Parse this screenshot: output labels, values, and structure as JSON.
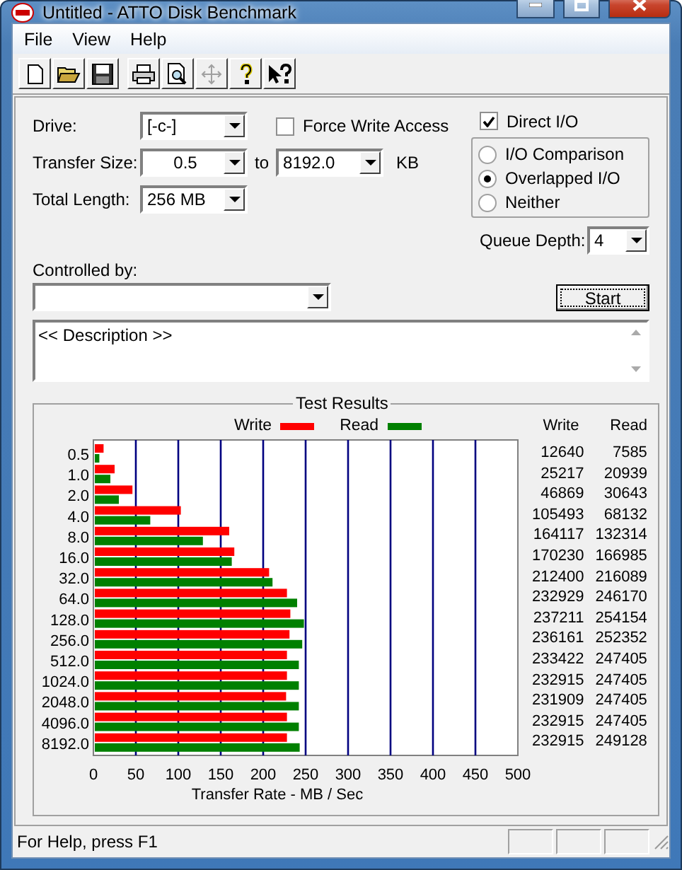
{
  "window": {
    "title": "Untitled - ATTO Disk Benchmark"
  },
  "menu": [
    {
      "label": "File"
    },
    {
      "label": "View"
    },
    {
      "label": "Help"
    }
  ],
  "toolbar": [
    {
      "buttons": [
        {
          "kind": "new",
          "disabled": false
        },
        {
          "kind": "open",
          "disabled": false
        },
        {
          "kind": "save",
          "disabled": false
        }
      ]
    },
    {
      "buttons": [
        {
          "kind": "print",
          "disabled": false
        },
        {
          "kind": "preview",
          "disabled": false
        },
        {
          "kind": "move",
          "disabled": true
        },
        {
          "kind": "help",
          "disabled": false
        },
        {
          "kind": "context-help",
          "disabled": false
        }
      ]
    }
  ],
  "drive": {
    "label": "Drive:",
    "value": "[-c-]"
  },
  "transfer_size": {
    "label": "Transfer Size:",
    "from": "0.5",
    "to_label": "to",
    "to": "8192.0",
    "unit": "KB"
  },
  "total_length": {
    "label": "Total Length:",
    "value": "256 MB"
  },
  "force_write_access": {
    "label": "Force Write Access",
    "checked": false
  },
  "direct_io": {
    "label": "Direct I/O",
    "checked": true
  },
  "io_mode": [
    {
      "label": "I/O Comparison",
      "selected": false
    },
    {
      "label": "Overlapped I/O",
      "selected": true
    },
    {
      "label": "Neither",
      "selected": false
    }
  ],
  "queue_depth": {
    "label": "Queue Depth:",
    "value": "4"
  },
  "controlled_by": {
    "label": "Controlled by:"
  },
  "start_button": "Start",
  "description": "<< Description >>",
  "results": {
    "title": "Test Results",
    "table_columns": [
      "Write",
      "Read"
    ],
    "rows": [
      {
        "write": "12640",
        "read": "7585"
      },
      {
        "write": "25217",
        "read": "20939"
      },
      {
        "write": "46869",
        "read": "30643"
      },
      {
        "write": "105493",
        "read": "68132"
      },
      {
        "write": "164117",
        "read": "132314"
      },
      {
        "write": "170230",
        "read": "166985"
      },
      {
        "write": "212400",
        "read": "216089"
      },
      {
        "write": "232929",
        "read": "246170"
      },
      {
        "write": "237211",
        "read": "254154"
      },
      {
        "write": "236161",
        "read": "252352"
      },
      {
        "write": "233422",
        "read": "247405"
      },
      {
        "write": "232915",
        "read": "247405"
      },
      {
        "write": "231909",
        "read": "247405"
      },
      {
        "write": "232915",
        "read": "247405"
      },
      {
        "write": "232915",
        "read": "249128"
      }
    ],
    "chart_data": {
      "type": "bar",
      "orientation": "horizontal",
      "xlabel": "Transfer Rate - MB / Sec",
      "categories": [
        "0.5",
        "1.0",
        "2.0",
        "4.0",
        "8.0",
        "16.0",
        "32.0",
        "64.0",
        "128.0",
        "256.0",
        "512.0",
        "1024.0",
        "2048.0",
        "4096.0",
        "8192.0"
      ],
      "series": [
        {
          "name": "Write",
          "color": "#ff0000",
          "values": [
            12,
            25,
            46,
            103,
            160,
            166,
            207,
            228,
            232,
            231,
            228,
            228,
            227,
            228,
            228
          ]
        },
        {
          "name": "Read",
          "color": "#008000",
          "values": [
            7,
            20,
            30,
            67,
            129,
            163,
            211,
            240,
            248,
            246,
            242,
            242,
            242,
            242,
            243
          ]
        }
      ],
      "grid": true,
      "xlim": [
        0,
        500
      ],
      "xticks": [
        0,
        50,
        100,
        150,
        200,
        250,
        300,
        350,
        400,
        450,
        500
      ]
    }
  },
  "status_bar": {
    "text": "For Help, press F1"
  }
}
